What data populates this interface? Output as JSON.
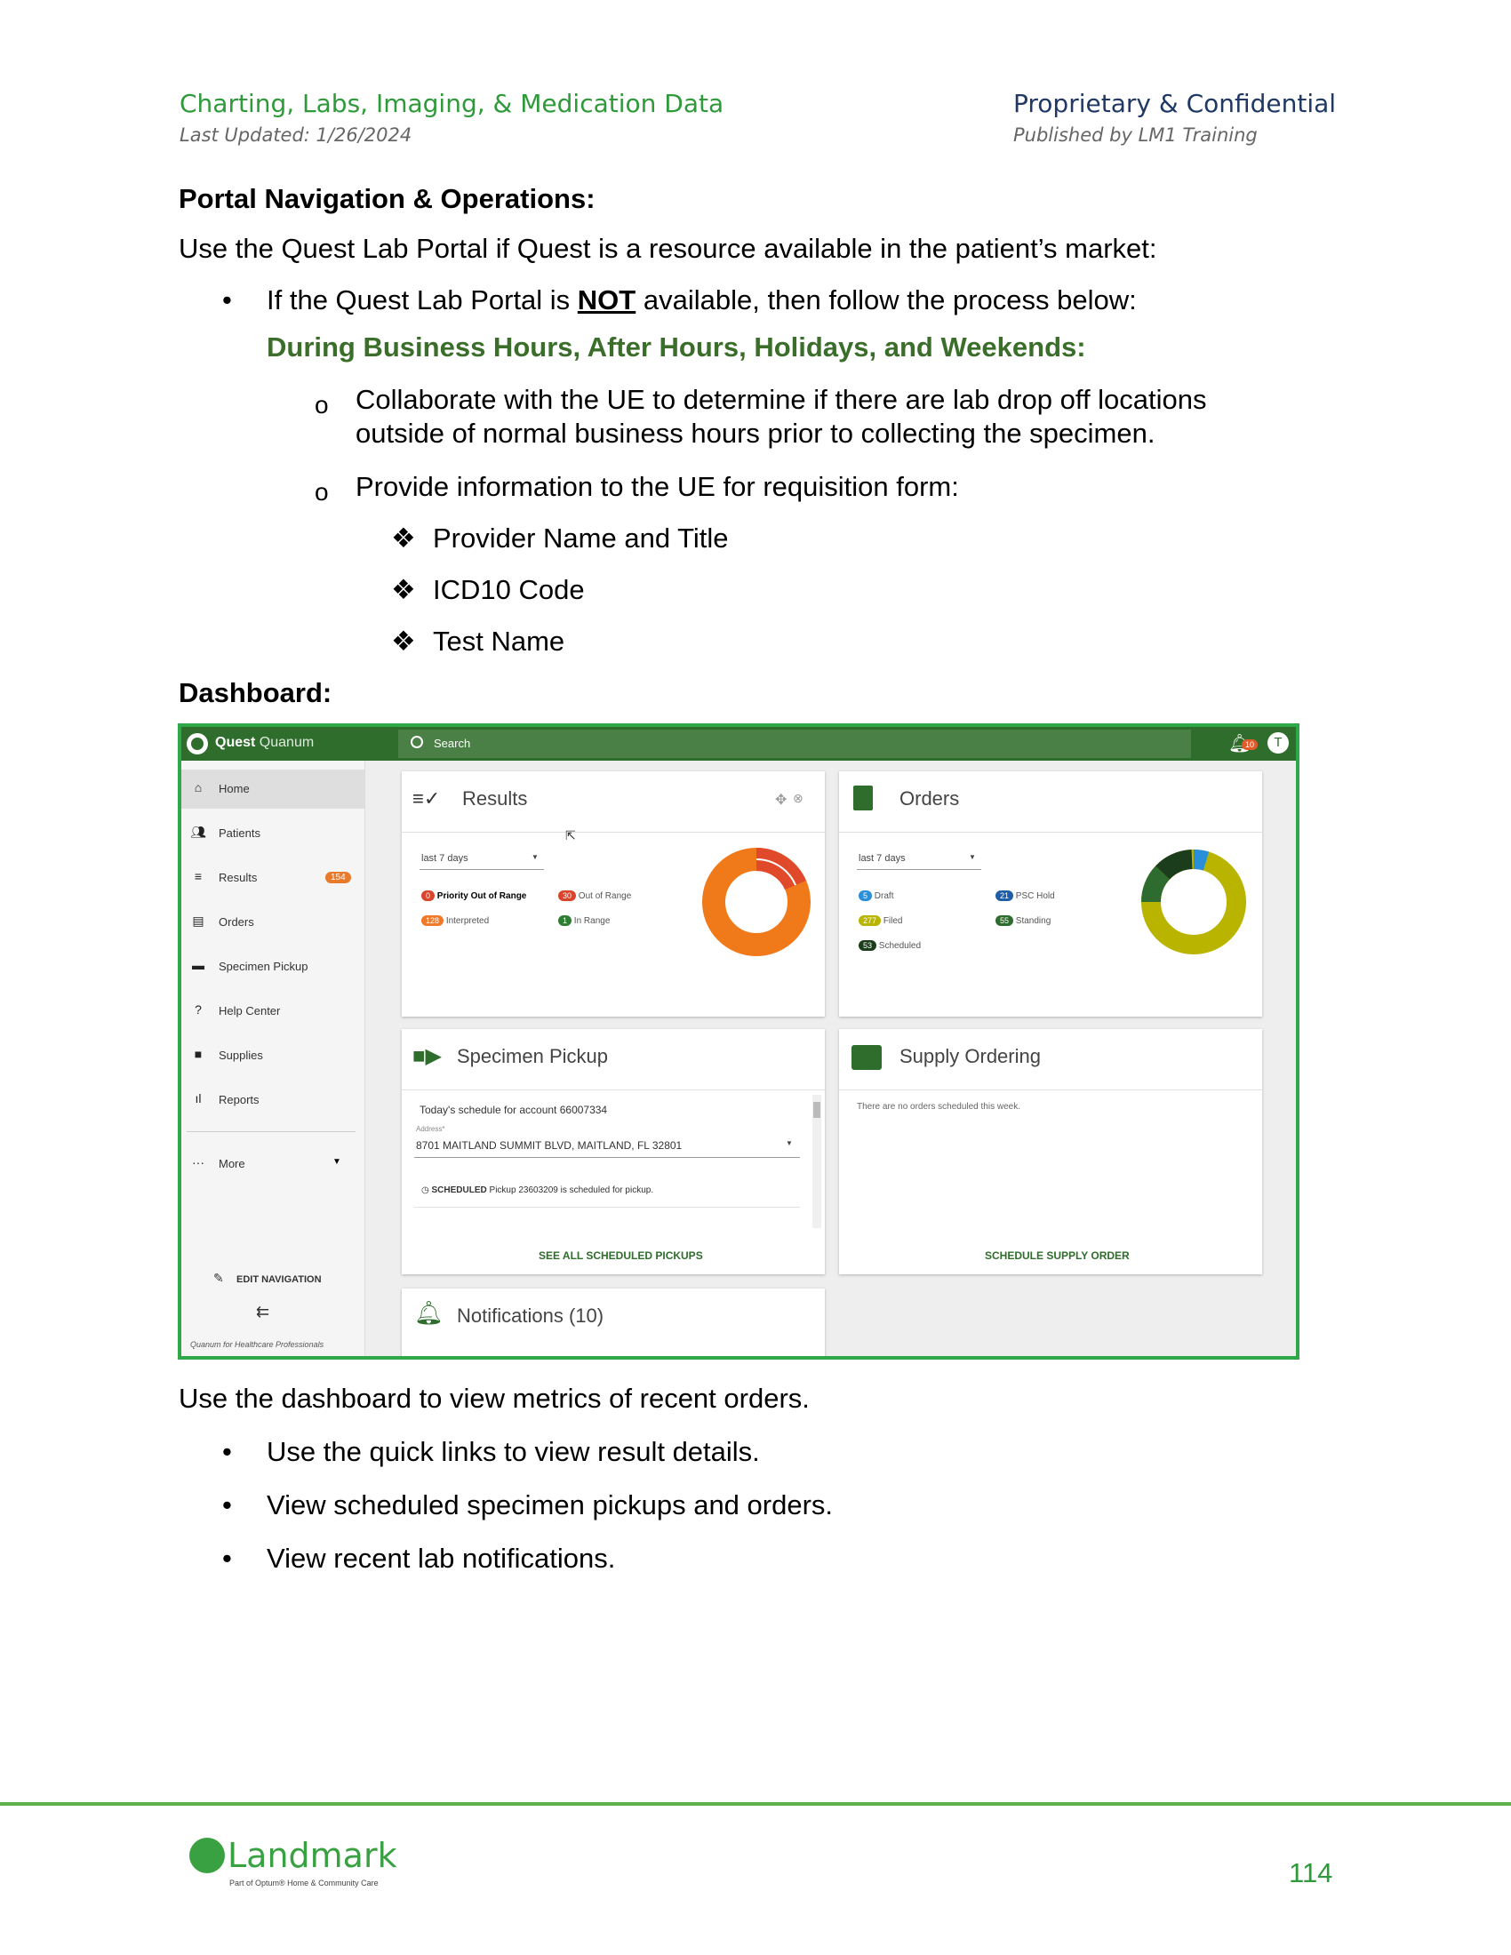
{
  "header": {
    "title": "Charting, Labs, Imaging, & Medication Data",
    "updated": "Last Updated: 1/26/2024",
    "confidential": "Proprietary & Confidential",
    "publisher": "Published by LM1 Training"
  },
  "content": {
    "section1_title": "Portal Navigation & Operations:",
    "intro": "Use the Quest Lab Portal if Quest is a resource available in the patient’s market:",
    "bullet1_pre": "If the Quest Lab Portal is ",
    "bullet1_emph": "NOT",
    "bullet1_post": " available, then follow the process below:",
    "subheading": "During Business Hours, After Hours, Holidays, and Weekends:",
    "sub1_line1": "Collaborate with the UE to determine if there are lab drop off locations",
    "sub1_line2": "outside of normal business hours prior to collecting the specimen.",
    "sub2": "Provide information to the UE for requisition form:",
    "items": [
      "Provider Name and Title",
      "ICD10 Code",
      "Test Name"
    ],
    "dashboard_title": "Dashboard:",
    "after_text": "Use the dashboard to view metrics of recent orders.",
    "after_bullets": [
      "Use the quick links to view result details.",
      "View scheduled specimen pickups and orders.",
      "View recent lab notifications."
    ]
  },
  "screenshot": {
    "brand": "Quest",
    "brand_sub": "Quanum",
    "search_placeholder": "Search",
    "notif_count": "10",
    "avatar": "T",
    "sidebar": [
      {
        "label": "Home",
        "icon": "home-icon"
      },
      {
        "label": "Patients",
        "icon": "people-icon"
      },
      {
        "label": "Results",
        "icon": "results-icon"
      },
      {
        "label": "Orders",
        "icon": "document-icon"
      },
      {
        "label": "Specimen Pickup",
        "icon": "truck-icon"
      },
      {
        "label": "Help Center",
        "icon": "help-icon"
      },
      {
        "label": "Supplies",
        "icon": "briefcase-icon"
      },
      {
        "label": "Reports",
        "icon": "bar-chart-icon"
      }
    ],
    "results_badge": "154",
    "more": "More",
    "edit_nav": "EDIT NAVIGATION",
    "footer": "Quanum for Healthcare Professionals",
    "results": {
      "title": "Results",
      "range": "last 7 days",
      "legend": [
        {
          "count": "0",
          "label": "Priority Out of Range",
          "color": "#d9442a"
        },
        {
          "count": "30",
          "label": "Out of Range",
          "color": "#d9442a"
        },
        {
          "count": "128",
          "label": "Interpreted",
          "color": "#f07a2a"
        },
        {
          "count": "1",
          "label": "In Range",
          "color": "#2e7d32"
        }
      ]
    },
    "orders": {
      "title": "Orders",
      "range": "last 7 days",
      "legend": [
        {
          "count": "5",
          "label": "Draft",
          "color": "#2a8fd9"
        },
        {
          "count": "21",
          "label": "PSC Hold",
          "color": "#1e5fa8"
        },
        {
          "count": "277",
          "label": "Filed",
          "color": "#b8b400"
        },
        {
          "count": "55",
          "label": "Standing",
          "color": "#2e6b2e"
        },
        {
          "count": "53",
          "label": "Scheduled",
          "color": "#1b3d1b"
        }
      ]
    },
    "pickup": {
      "title": "Specimen Pickup",
      "schedule": "Today's schedule for account 66007334",
      "address_label": "Address*",
      "address": "8701 MAITLAND SUMMIT BLVD, MAITLAND, FL 32801",
      "status": "SCHEDULED",
      "status_text": "Pickup 23603209 is scheduled for pickup.",
      "link": "SEE ALL SCHEDULED PICKUPS"
    },
    "supply": {
      "title": "Supply Ordering",
      "empty": "There are no orders scheduled this week.",
      "link": "SCHEDULE SUPPLY ORDER"
    },
    "notifications": {
      "title": "Notifications (10)"
    }
  },
  "footer": {
    "logo_text": "Landmark",
    "logo_sub": "Part of Optum® Home & Community Care",
    "page": "114"
  }
}
